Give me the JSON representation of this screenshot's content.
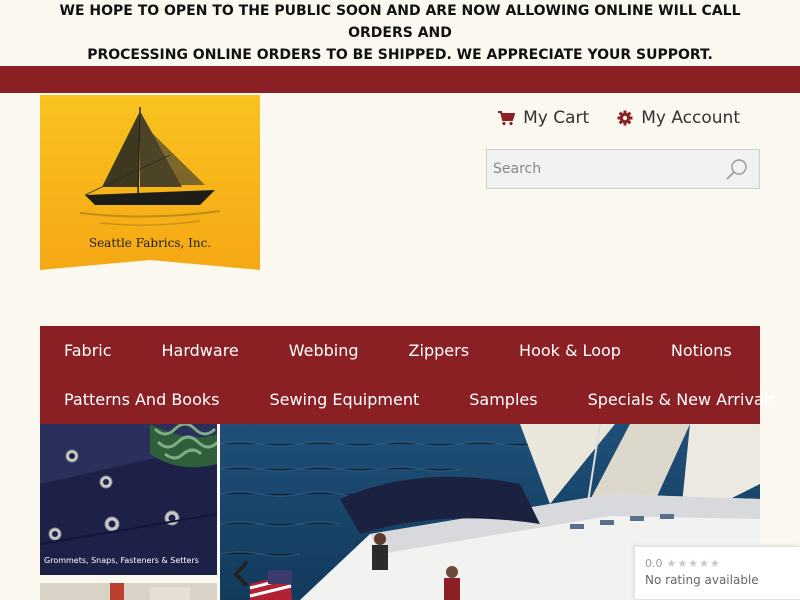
{
  "announcement": {
    "line1": "WE HOPE TO OPEN TO THE PUBLIC SOON AND ARE NOW ALLOWING ONLINE WILL CALL ORDERS AND",
    "line2": "PROCESSING ONLINE ORDERS TO BE SHIPPED. WE APPRECIATE YOUR SUPPORT."
  },
  "brand": {
    "logo_text": "Seattle Fabrics, Inc."
  },
  "header": {
    "cart_label": "My Cart",
    "account_label": "My Account",
    "search_placeholder": "Search"
  },
  "nav": {
    "row1": [
      {
        "label": "Fabric"
      },
      {
        "label": "Hardware"
      },
      {
        "label": "Webbing"
      },
      {
        "label": "Zippers"
      },
      {
        "label": "Hook & Loop"
      },
      {
        "label": "Notions"
      }
    ],
    "row2": [
      {
        "label": "Patterns And Books"
      },
      {
        "label": "Sewing Equipment"
      },
      {
        "label": "Samples"
      },
      {
        "label": "Specials & New Arrivals"
      }
    ]
  },
  "featured": {
    "thumb1_caption": "Grommets, Snaps, Fasteners & Setters"
  },
  "rating_widget": {
    "score": "0.0",
    "text": "No rating available"
  },
  "colors": {
    "brand_red": "#8b2024",
    "background": "#fbf8f0",
    "logo_yellow": "#f7b619"
  }
}
